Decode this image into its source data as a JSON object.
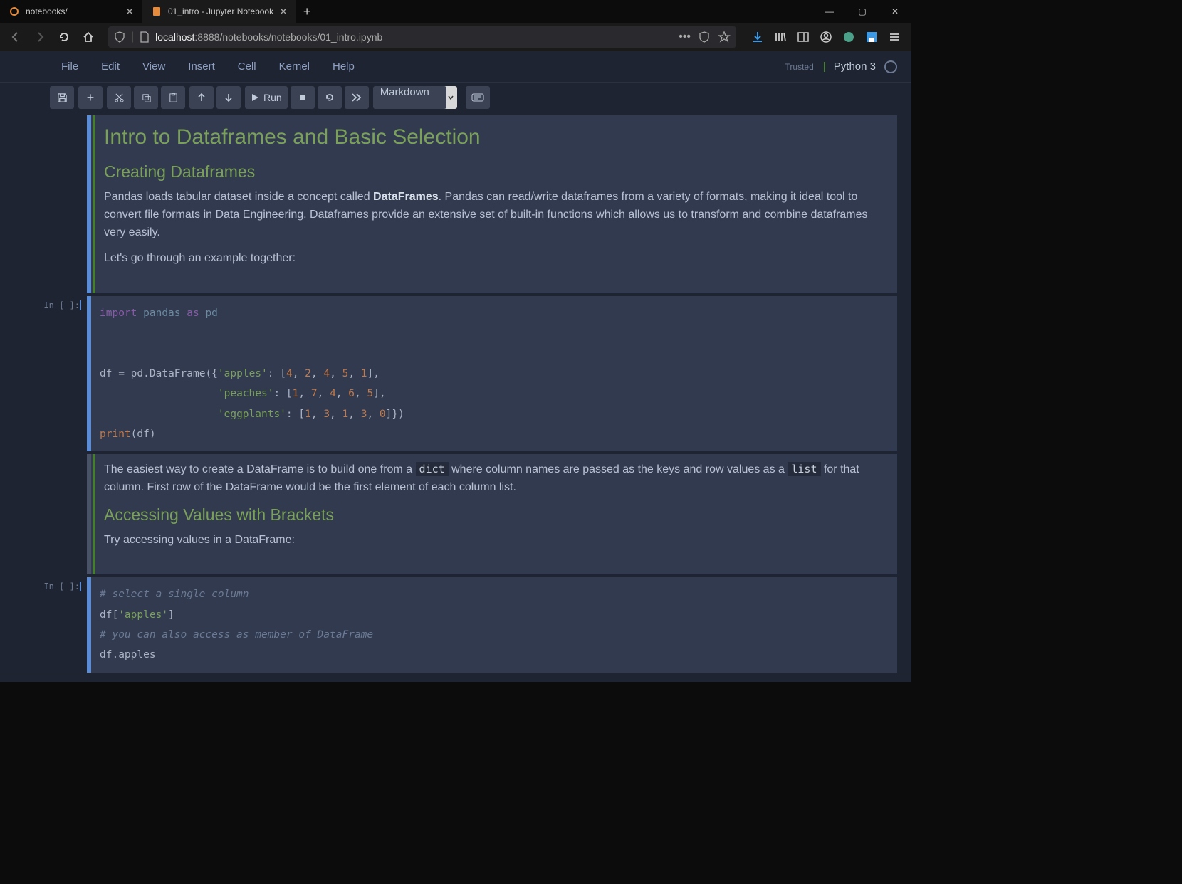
{
  "browser": {
    "tabs": [
      {
        "title": "notebooks/",
        "active": false
      },
      {
        "title": "01_intro - Jupyter Notebook",
        "active": true
      }
    ],
    "url_host": "localhost",
    "url_port_path": ":8888/notebooks/notebooks/01_intro.ipynb"
  },
  "jupyter": {
    "menu": [
      "File",
      "Edit",
      "View",
      "Insert",
      "Cell",
      "Kernel",
      "Help"
    ],
    "trusted": "Trusted",
    "kernel_name": "Python 3",
    "run_label": "Run",
    "cell_type": "Markdown"
  },
  "cells": {
    "md1": {
      "h1": "Intro to Dataframes and Basic Selection",
      "h2": "Creating Dataframes",
      "p1a": "Pandas loads tabular dataset inside a concept called ",
      "p1b": "DataFrames",
      "p1c": ". Pandas can read/write dataframes from a variety of formats, making it ideal tool to convert file formats in Data Engineering. Dataframes provide an extensive set of built-in functions which allows us to transform and combine dataframes very easily.",
      "p2": "Let's go through an example together:"
    },
    "code1": {
      "prompt": "In [ ]:"
    },
    "md2": {
      "p1a": "The easiest way to create a DataFrame is to build one from a ",
      "p1code1": "dict",
      "p1b": " where column names are passed as the keys and row values as a ",
      "p1code2": "list",
      "p1c": " for that column. First row of the DataFrame would be the first element of each column list.",
      "h2": "Accessing Values with Brackets",
      "p2": "Try accessing values in a DataFrame:"
    },
    "code2": {
      "prompt": "In [ ]:",
      "c1": "# select a single column",
      "line2a": "df[",
      "line2b": "'apples'",
      "line2c": "]",
      "c2": "# you can also access as member of DataFrame",
      "line4": "df.apples"
    }
  }
}
